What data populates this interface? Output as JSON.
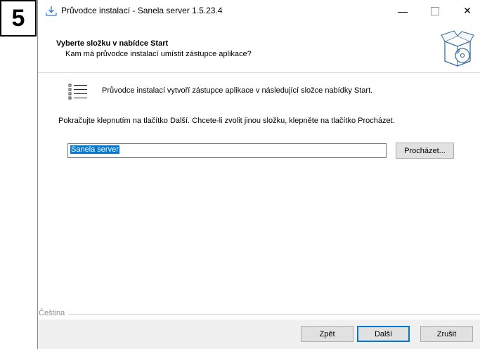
{
  "step_badge": "5",
  "window": {
    "title": "Průvodce instalací - Sanela server 1.5.23.4",
    "controls": {
      "minimize": "—",
      "close": "✕"
    }
  },
  "header": {
    "title": "Vyberte složku v nabídce Start",
    "subtitle": "Kam má průvodce instalací umístit zástupce aplikace?"
  },
  "content": {
    "intro": "Průvodce instalací vytvoří zástupce aplikace v následující složce nabídky Start.",
    "instruction": "Pokračujte klepnutím na tlačítko Další. Chcete-li zvolit jinou složku, klepněte na tlačítko Procházet.",
    "folder_value": "Sanela server",
    "browse_label": "Procházet..."
  },
  "language_label": "Čeština",
  "footer": {
    "back_label": "Zpět",
    "next_label": "Další",
    "cancel_label": "Zrušit"
  },
  "colors": {
    "selection": "#0078d7",
    "footer_bg": "#f0f0f0",
    "button_bg": "#e1e1e1"
  },
  "icons": [
    "installer-icon",
    "minimize-icon",
    "maximize-icon",
    "close-icon",
    "setup-box-icon",
    "list-icon"
  ]
}
